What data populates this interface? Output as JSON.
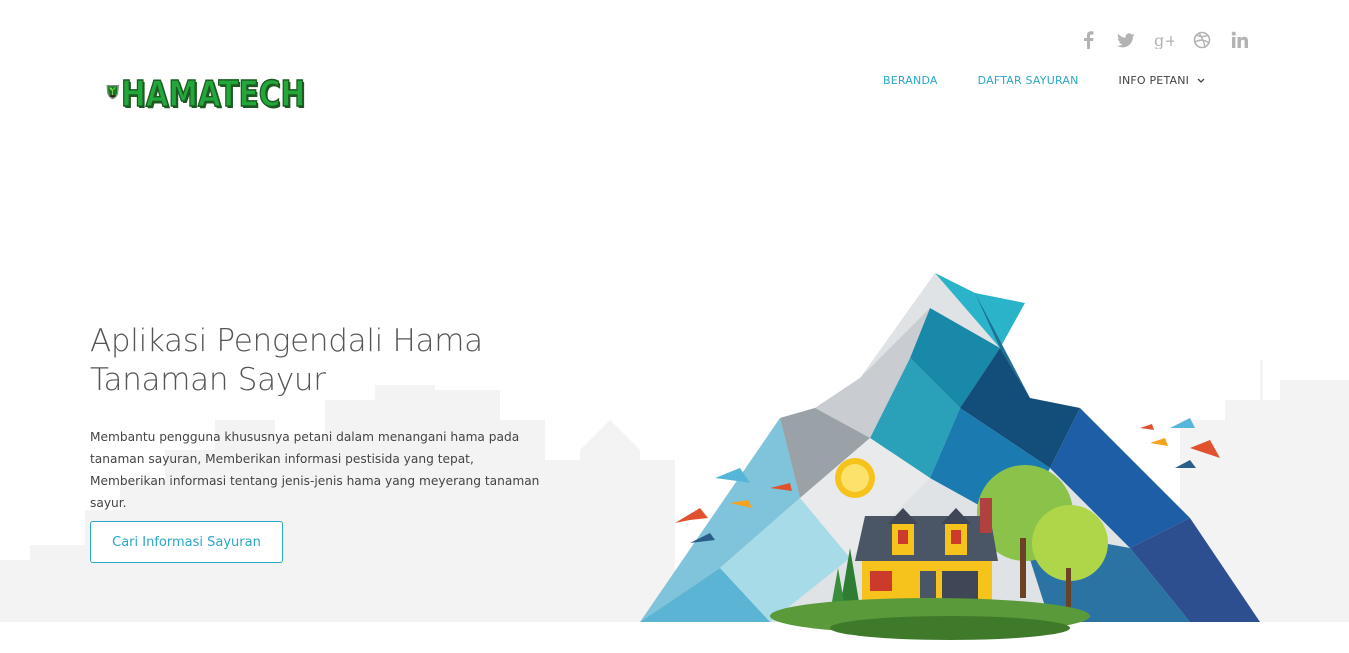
{
  "header": {
    "logo_text": "HAMATECH",
    "social": [
      {
        "icon": "facebook-icon",
        "glyph": "f"
      },
      {
        "icon": "twitter-icon",
        "glyph": "t"
      },
      {
        "icon": "google-plus-icon",
        "glyph": "g+"
      },
      {
        "icon": "dribbble-icon",
        "glyph": "d"
      },
      {
        "icon": "linkedin-icon",
        "glyph": "in"
      }
    ],
    "nav": {
      "home": "BERANDA",
      "vegetables": "DAFTAR SAYURAN",
      "farmer_info": "INFO PETANI"
    }
  },
  "hero": {
    "title_line1": "Aplikasi Pengendali Hama",
    "title_line2": "Tanaman Sayur",
    "description": "Membantu pengguna khususnya petani dalam menangani hama pada tanaman sayuran, Memberikan informasi pestisida yang tepat, Memberikan informasi tentang jenis-jenis hama yang meyerang tanaman sayur.",
    "button_label": "Cari Informasi Sayuran"
  },
  "colors": {
    "accent": "#2aa7c9",
    "logo_green": "#22a83a",
    "text": "#555555",
    "icon_gray": "#b3b3b3",
    "city_gray": "#f2f2f2"
  }
}
